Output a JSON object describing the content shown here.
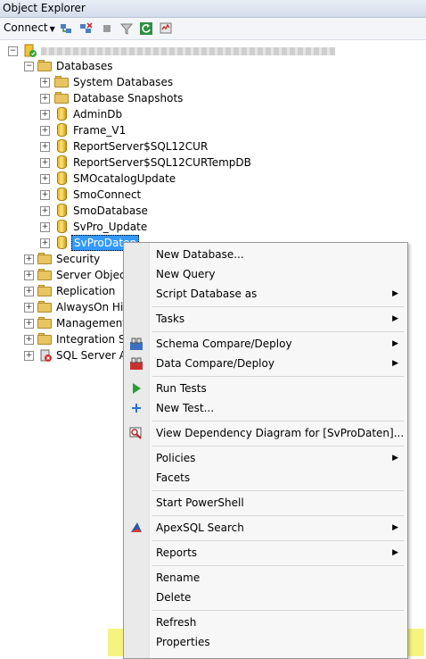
{
  "window": {
    "title": "Object Explorer"
  },
  "toolbar": {
    "connect_label": "Connect"
  },
  "tree": {
    "server": "",
    "databases": "Databases",
    "system_databases": "System Databases",
    "database_snapshots": "Database Snapshots",
    "dbs": [
      "AdminDb",
      "Frame_V1",
      "ReportServer$SQL12CUR",
      "ReportServer$SQL12CURTempDB",
      "SMOcatalogUpdate",
      "SmoConnect",
      "SmoDatabase",
      "SvPro_Update",
      "SvProDaten"
    ],
    "top": [
      "Security",
      "Server Objects",
      "Replication",
      "AlwaysOn High",
      "Management",
      "Integration Ser",
      "SQL Server Age"
    ]
  },
  "menu": {
    "new_database": "New Database...",
    "new_query": "New Query",
    "script_database_as": "Script Database as",
    "tasks": "Tasks",
    "schema_compare": "Schema Compare/Deploy",
    "data_compare": "Data Compare/Deploy",
    "run_tests": "Run Tests",
    "new_test": "New Test...",
    "view_dependency": "View Dependency Diagram for [SvProDaten]...",
    "policies": "Policies",
    "facets": "Facets",
    "start_powershell": "Start PowerShell",
    "apexsql_search": "ApexSQL Search",
    "reports": "Reports",
    "rename": "Rename",
    "delete": "Delete",
    "refresh": "Refresh",
    "properties": "Properties"
  }
}
